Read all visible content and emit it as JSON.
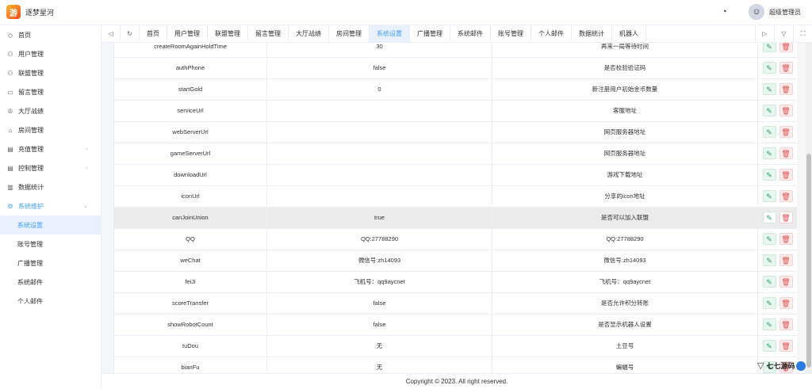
{
  "app": {
    "title": "逐梦星河",
    "logo_glyph": "游"
  },
  "header": {
    "username": "超级管理员",
    "palette_icon": "palette-icon"
  },
  "sidebar": {
    "items": [
      {
        "label": "首页",
        "icon": "◇"
      },
      {
        "label": "用户管理",
        "icon": "⚇"
      },
      {
        "label": "联盟管理",
        "icon": "⚇"
      },
      {
        "label": "留言管理",
        "icon": "▭"
      },
      {
        "label": "大厅战绩",
        "icon": "♔"
      },
      {
        "label": "房间管理",
        "icon": "⌂"
      },
      {
        "label": "充值管理",
        "icon": "▤",
        "arrow": "‹"
      },
      {
        "label": "控制管理",
        "icon": "▤",
        "arrow": "‹"
      },
      {
        "label": "数据统计",
        "icon": "▥"
      },
      {
        "label": "系统维护",
        "icon": "⚙",
        "arrow": "⌄"
      }
    ],
    "subitems": [
      {
        "label": "系统设置"
      },
      {
        "label": "账号管理"
      },
      {
        "label": "广播管理"
      },
      {
        "label": "系统邮件"
      },
      {
        "label": "个人邮件"
      }
    ]
  },
  "tabs": {
    "left_controls": [
      "◁",
      "↻"
    ],
    "items": [
      "首页",
      "用户管理",
      "联盟管理",
      "留言管理",
      "大厅战绩",
      "房间管理",
      "系统设置",
      "广播管理",
      "系统邮件",
      "账号管理",
      "个人邮件",
      "数据统计",
      "机器人"
    ],
    "active_index": 6,
    "right_controls": [
      "▷",
      "▽",
      "⛶"
    ]
  },
  "table": {
    "rows": [
      {
        "key": "createRoomAgainHoldTime",
        "value": "30",
        "desc": "再来一局等待时间"
      },
      {
        "key": "authPhone",
        "value": "false",
        "desc": "是否校验验证码"
      },
      {
        "key": "startGold",
        "value": "0",
        "desc": "新注册用户初始金币数量"
      },
      {
        "key": "serviceUrl",
        "value": "",
        "desc": "客服地址"
      },
      {
        "key": "webServerUrl",
        "value": "",
        "desc": "网页服务器地址"
      },
      {
        "key": "gameServerUrl",
        "value": "",
        "desc": "网页服务器地址"
      },
      {
        "key": "downloadUrl",
        "value": "",
        "desc": "游戏下载地址"
      },
      {
        "key": "iconUrl",
        "value": "",
        "desc": "分享的icon地址"
      },
      {
        "key": "canJoinUnion",
        "value": "true",
        "desc": "是否可以加入联盟"
      },
      {
        "key": "QQ",
        "value": "QQ:27788290",
        "desc": "QQ:27788290"
      },
      {
        "key": "weChat",
        "value": "微信号:zh14093",
        "desc": "微信号:zh14093"
      },
      {
        "key": "feiJi",
        "value": "飞机号：qq9aycnet",
        "desc": "飞机号：qq9aycnet"
      },
      {
        "key": "scoreTransfer",
        "value": "false",
        "desc": "是否允许积分转账"
      },
      {
        "key": "showRobotCount",
        "value": "false",
        "desc": "是否显示机器人设置"
      },
      {
        "key": "tuDou",
        "value": "无",
        "desc": "土豆号"
      },
      {
        "key": "bianFu",
        "value": "无",
        "desc": "蝙蝠号"
      }
    ],
    "highlighted_index": 8,
    "edit_icon": "✎",
    "delete_icon": "🗑"
  },
  "footer": {
    "copyright": "Copyright © 2023. All right reserved."
  },
  "watermark": {
    "text": "七七源码"
  },
  "colors": {
    "accent": "#409eff",
    "edit": "#2e9e5e",
    "delete": "#e04d4d"
  }
}
